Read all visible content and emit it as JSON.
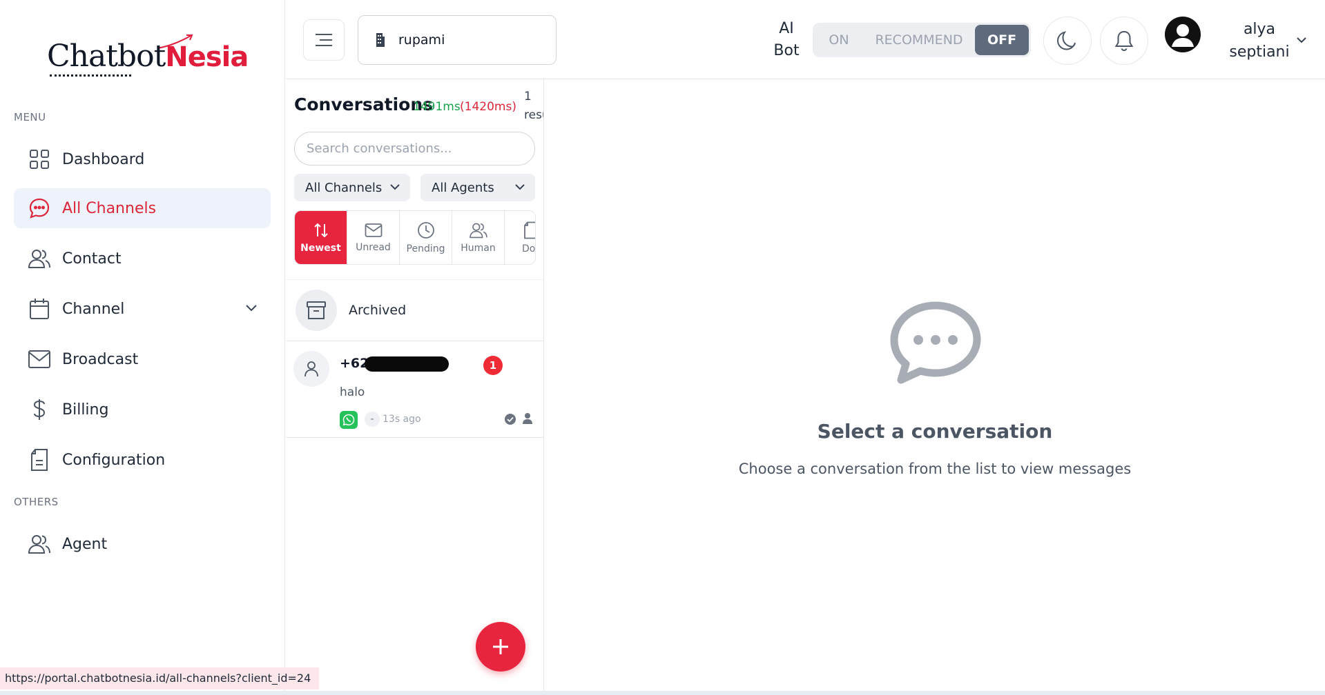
{
  "brand": {
    "name_part1": "Chatbot",
    "name_part2": "Nesia"
  },
  "sidebar": {
    "menu_label": "MENU",
    "others_label": "OTHERS",
    "items": [
      {
        "label": "Dashboard",
        "icon": "grid-icon"
      },
      {
        "label": "All Channels",
        "icon": "chat-icon",
        "active": true
      },
      {
        "label": "Contact",
        "icon": "users-icon"
      },
      {
        "label": "Channel",
        "icon": "calendar-icon",
        "has_submenu": true
      },
      {
        "label": "Broadcast",
        "icon": "mail-icon"
      },
      {
        "label": "Billing",
        "icon": "dollar-icon"
      },
      {
        "label": "Configuration",
        "icon": "document-settings-icon"
      }
    ],
    "others_items": [
      {
        "label": "Agent",
        "icon": "users-icon"
      }
    ]
  },
  "topbar": {
    "client": "rupami",
    "ai_bot_label": "AI Bot",
    "ai_bot_line1": "AI",
    "ai_bot_line2": "Bot",
    "mode_options": [
      "ON",
      "RECOMMEND",
      "OFF"
    ],
    "mode_selected": "OFF",
    "user_first": "alya",
    "user_last": "septiani"
  },
  "conversations": {
    "title": "Conversations",
    "timing_primary": "1491ms",
    "timing_secondary": "(1420ms)",
    "results_count": "1",
    "results_label": "resu",
    "search_placeholder": "Search conversations...",
    "channel_filter": "All Channels",
    "agent_filter": "All Agents",
    "tabs": [
      {
        "label": "Newest",
        "icon": "sort-arrows-icon",
        "active": true
      },
      {
        "label": "Unread",
        "icon": "mail-icon"
      },
      {
        "label": "Pending",
        "icon": "clock-icon"
      },
      {
        "label": "Human",
        "icon": "users-icon"
      },
      {
        "label": "Dor",
        "icon": "document-icon"
      }
    ],
    "archived_label": "Archived",
    "items": [
      {
        "phone_prefix": "+628",
        "unread": "1",
        "message": "halo",
        "channel_icon": "whatsapp-icon",
        "agent": "-",
        "time": "13s ago"
      }
    ]
  },
  "main": {
    "empty_title": "Select a conversation",
    "empty_subtitle": "Choose a conversation from the list to view messages"
  },
  "status_url": "https://portal.chatbotnesia.id/all-channels?client_id=24",
  "colors": {
    "brand_red": "#e8253f",
    "active_bg": "#eef2fb",
    "mode_off": "#5f6b7d",
    "timing_green": "#16a34a"
  }
}
